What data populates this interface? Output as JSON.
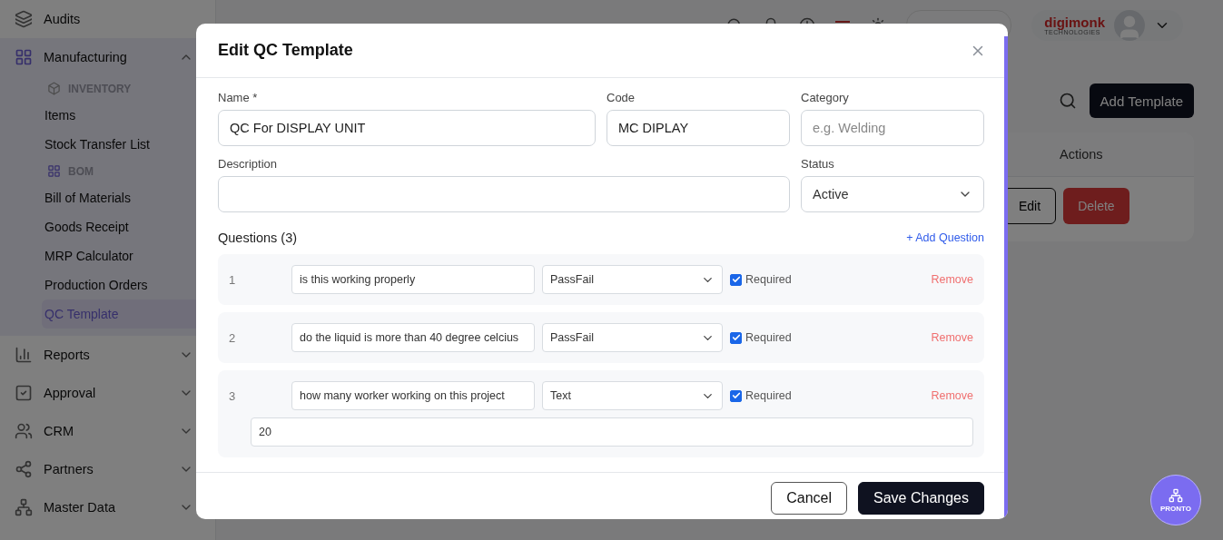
{
  "sidebar": {
    "items": [
      {
        "kind": "section",
        "label": "Audits",
        "selected": false
      },
      {
        "kind": "section",
        "label": "Manufacturing",
        "expanded": true,
        "selected": true,
        "children": [
          {
            "kind": "group",
            "label": "INVENTORY"
          },
          {
            "kind": "link",
            "label": "Items",
            "selected": false
          },
          {
            "kind": "link",
            "label": "Stock Transfer List",
            "selected": false
          },
          {
            "kind": "group",
            "label": "BOM"
          },
          {
            "kind": "link",
            "label": "Bill of Materials",
            "selected": false
          },
          {
            "kind": "link",
            "label": "Goods Receipt",
            "selected": false
          },
          {
            "kind": "link",
            "label": "MRP Calculator",
            "selected": false
          },
          {
            "kind": "link",
            "label": "Production Orders",
            "selected": false
          },
          {
            "kind": "link",
            "label": "QC Template",
            "selected": true
          }
        ]
      },
      {
        "kind": "section",
        "label": "Reports",
        "expanded": false,
        "selected": false
      },
      {
        "kind": "section",
        "label": "Approval",
        "expanded": false,
        "selected": false
      },
      {
        "kind": "section",
        "label": "CRM",
        "expanded": false,
        "selected": false
      },
      {
        "kind": "section",
        "label": "Partners",
        "expanded": false,
        "selected": false
      },
      {
        "kind": "section",
        "label": "Master Data",
        "expanded": false,
        "selected": false
      }
    ]
  },
  "header": {
    "brand": {
      "name": "digimonk",
      "tagline": "TECHNOLOGIES"
    }
  },
  "page": {
    "add_button": "Add Template",
    "table": {
      "columns": [
        "Actions"
      ],
      "row_actions": [
        "Edit",
        "Delete"
      ]
    }
  },
  "modal": {
    "title": "Edit QC Template",
    "fields": [
      {
        "kind": "input",
        "label": "Name *",
        "value": "QC For DISPLAY UNIT"
      },
      {
        "kind": "input",
        "label": "Code",
        "value": "MC DIPLAY"
      },
      {
        "kind": "input",
        "label": "Category",
        "placeholder": "e.g. Welding"
      },
      {
        "kind": "input",
        "label": "Description",
        "wide": true
      },
      {
        "kind": "select",
        "label": "Status",
        "value": "Active"
      }
    ],
    "questions_title": "Questions (3)",
    "add_question": "+ Add Question",
    "questions": [
      {
        "number": "1",
        "text": "is this working properly",
        "type": "PassFail",
        "required": true,
        "required_label": "Required",
        "remove": "Remove"
      },
      {
        "number": "2",
        "text": "do the liquid is more than 40 degree celcius",
        "type": "PassFail",
        "required": true,
        "required_label": "Required",
        "remove": "Remove"
      },
      {
        "number": "3",
        "text": "how many worker working on this project",
        "type": "Text",
        "required": true,
        "required_label": "Required",
        "remove": "Remove",
        "answer": "20"
      }
    ],
    "buttons": [
      {
        "kind": "secondary",
        "label": "Cancel"
      },
      {
        "kind": "primary",
        "label": "Save Changes"
      }
    ]
  },
  "assistant": {
    "label": "PRONTO"
  }
}
